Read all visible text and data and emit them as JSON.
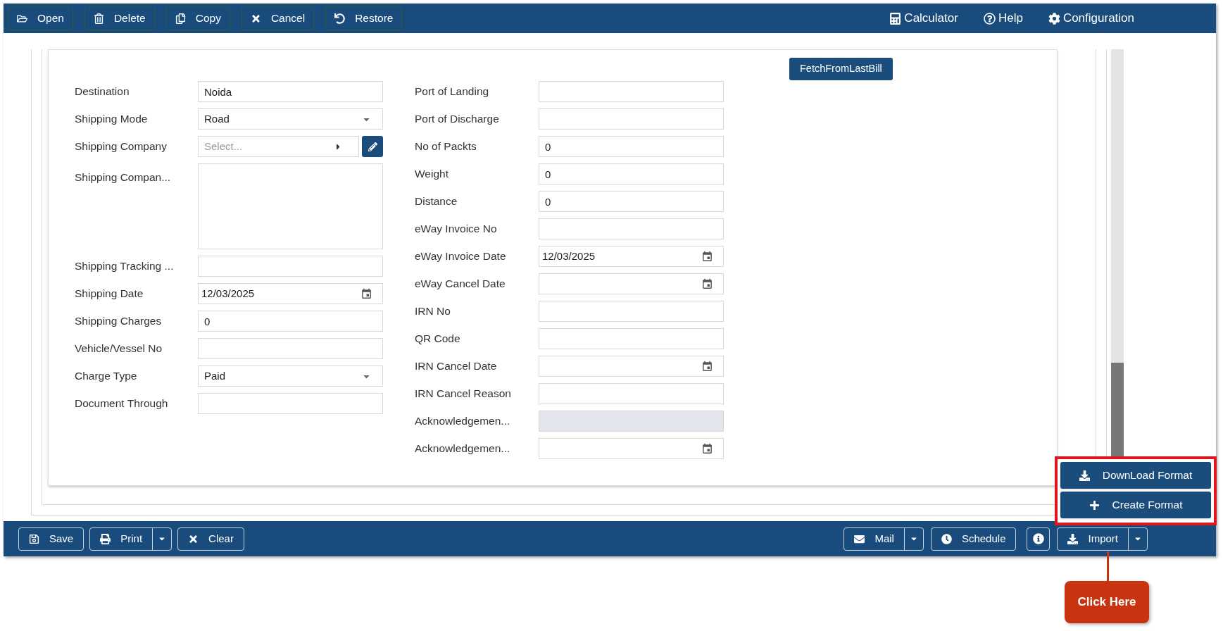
{
  "top_toolbar": {
    "left": [
      {
        "label": "Open"
      },
      {
        "label": "Delete"
      },
      {
        "label": "Copy"
      },
      {
        "label": "Cancel"
      },
      {
        "label": "Restore"
      }
    ],
    "right": [
      {
        "label": "Calculator"
      },
      {
        "label": "Help"
      },
      {
        "label": "Configuration"
      }
    ]
  },
  "form": {
    "fetch_button": "FetchFromLastBill",
    "left_fields": [
      {
        "label": "Destination",
        "kind": "text",
        "value": "Noida"
      },
      {
        "label": "Shipping Mode",
        "kind": "select",
        "value": "Road"
      },
      {
        "label": "Shipping Company",
        "kind": "lookup",
        "placeholder": "Select..."
      },
      {
        "label": "Shipping Compan...",
        "kind": "textarea"
      },
      {
        "label": "Shipping Tracking ...",
        "kind": "text"
      },
      {
        "label": "Shipping Date",
        "kind": "date",
        "value": "12/03/2025"
      },
      {
        "label": "Shipping Charges",
        "kind": "text",
        "value": "0"
      },
      {
        "label": "Vehicle/Vessel No",
        "kind": "text"
      },
      {
        "label": "Charge Type",
        "kind": "select",
        "value": "Paid"
      },
      {
        "label": "Document Through",
        "kind": "text"
      }
    ],
    "right_fields": [
      {
        "label": "Port of Landing",
        "kind": "text",
        "disabled": false
      },
      {
        "label": "Port of Discharge",
        "kind": "text",
        "disabled": false
      },
      {
        "label": "No of Packts",
        "kind": "text",
        "value": "0",
        "disabled": false
      },
      {
        "label": "Weight",
        "kind": "text",
        "value": "0",
        "disabled": false
      },
      {
        "label": "Distance",
        "kind": "text",
        "value": "0",
        "disabled": false
      },
      {
        "label": "eWay Invoice No",
        "kind": "text",
        "disabled": false
      },
      {
        "label": "eWay Invoice Date",
        "kind": "date",
        "value": "12/03/2025",
        "disabled": false
      },
      {
        "label": "eWay Cancel Date",
        "kind": "date",
        "disabled": false
      },
      {
        "label": "IRN No",
        "kind": "text",
        "disabled": false
      },
      {
        "label": "QR Code",
        "kind": "text",
        "disabled": false
      },
      {
        "label": "IRN Cancel Date",
        "kind": "date",
        "disabled": false
      },
      {
        "label": "IRN Cancel Reason",
        "kind": "text",
        "disabled": false
      },
      {
        "label": "Acknowledgemen...",
        "kind": "text",
        "disabled": true
      },
      {
        "label": "Acknowledgemen...",
        "kind": "date",
        "disabled": false
      }
    ]
  },
  "bottom_bar": {
    "left": [
      {
        "label": "Save",
        "has_menu": false
      },
      {
        "label": "Print",
        "has_menu": true
      },
      {
        "label": "Clear",
        "has_menu": false
      }
    ],
    "right": [
      {
        "label": "Mail",
        "has_menu": true
      },
      {
        "label": "Schedule",
        "has_menu": false
      },
      {
        "label": "Import",
        "has_menu": true
      }
    ]
  },
  "import_menu": [
    "DownLoad Format",
    "Create Format"
  ],
  "callout": "Click Here"
}
